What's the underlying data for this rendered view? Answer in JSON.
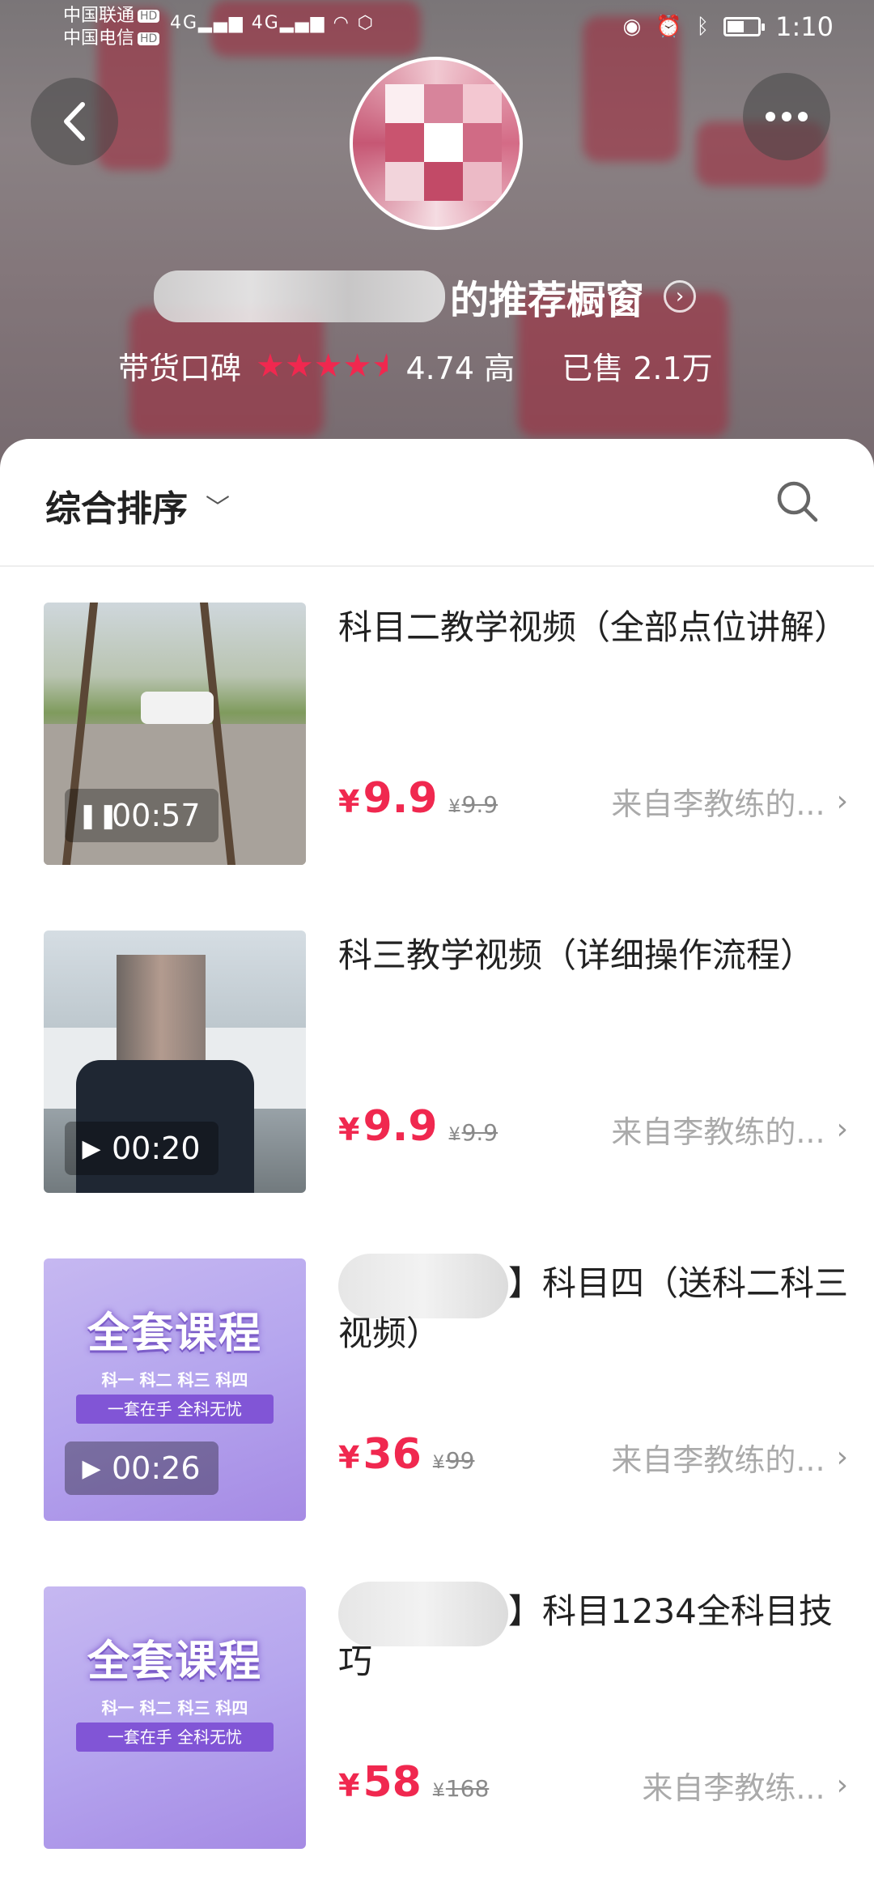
{
  "status_bar": {
    "carrier_1": "中国联通",
    "carrier_2": "中国电信",
    "hd_badge": "HD",
    "network": "4G",
    "time": "1:10"
  },
  "header": {
    "shop_title_suffix": "的推荐橱窗",
    "rating_label": "带货口碑",
    "rating_score": "4.74 高",
    "rating_value": 4.74,
    "sold_text": "已售 2.1万"
  },
  "sortbar": {
    "sort_label": "综合排序"
  },
  "products": [
    {
      "title": "科目二教学视频（全部点位讲解）",
      "title_redacted": false,
      "duration": "00:57",
      "play_state": "paused",
      "price": "9.9",
      "original_price": "9.9",
      "source": "来自李教练的..."
    },
    {
      "title": "科三教学视频（详细操作流程）",
      "title_redacted": false,
      "duration": "00:20",
      "play_state": "play",
      "price": "9.9",
      "original_price": "9.9",
      "source": "来自李教练的..."
    },
    {
      "title": "】科目四（送科二科三视频）",
      "title_redacted": true,
      "duration": "00:26",
      "play_state": "play",
      "price": "36",
      "original_price": "99",
      "source": "来自李教练的...",
      "thumb_title": "全套课程",
      "thumb_subtitle": "科一 科二 科三 科四",
      "thumb_banner": "一套在手 全科无忧"
    },
    {
      "title": "】科目1234全科目技巧",
      "title_redacted": true,
      "price": "58",
      "original_price": "168",
      "source": "来自李教练...",
      "thumb_title": "全套课程",
      "thumb_subtitle": "科一 科二 科三 科四",
      "thumb_banner": "一套在手 全科无忧"
    }
  ],
  "currency_symbol": "¥",
  "colors": {
    "price": "#f0284f",
    "star": "#f0284f",
    "muted": "#aaaaaa"
  }
}
